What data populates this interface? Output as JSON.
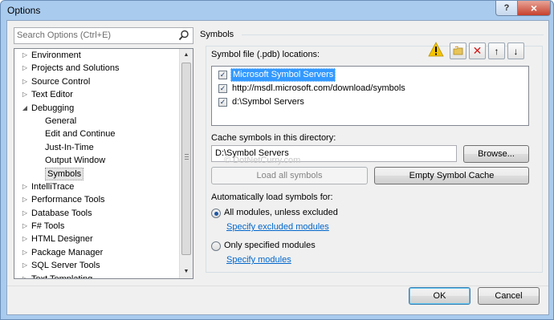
{
  "window": {
    "title": "Options",
    "help_glyph": "?",
    "close_glyph": "×"
  },
  "search": {
    "placeholder": "Search Options (Ctrl+E)"
  },
  "tree": [
    {
      "label": "Environment",
      "arrow": "▷",
      "level": 0
    },
    {
      "label": "Projects and Solutions",
      "arrow": "▷",
      "level": 0
    },
    {
      "label": "Source Control",
      "arrow": "▷",
      "level": 0
    },
    {
      "label": "Text Editor",
      "arrow": "▷",
      "level": 0
    },
    {
      "label": "Debugging",
      "arrow": "◢",
      "level": 0
    },
    {
      "label": "General",
      "arrow": "",
      "level": 1
    },
    {
      "label": "Edit and Continue",
      "arrow": "",
      "level": 1
    },
    {
      "label": "Just-In-Time",
      "arrow": "",
      "level": 1
    },
    {
      "label": "Output Window",
      "arrow": "",
      "level": 1
    },
    {
      "label": "Symbols",
      "arrow": "",
      "level": 1,
      "selected": true
    },
    {
      "label": "IntelliTrace",
      "arrow": "▷",
      "level": 0
    },
    {
      "label": "Performance Tools",
      "arrow": "▷",
      "level": 0
    },
    {
      "label": "Database Tools",
      "arrow": "▷",
      "level": 0
    },
    {
      "label": "F# Tools",
      "arrow": "▷",
      "level": 0
    },
    {
      "label": "HTML Designer",
      "arrow": "▷",
      "level": 0
    },
    {
      "label": "Package Manager",
      "arrow": "▷",
      "level": 0
    },
    {
      "label": "SQL Server Tools",
      "arrow": "▷",
      "level": 0
    },
    {
      "label": "Text Templating",
      "arrow": "▷",
      "level": 0
    }
  ],
  "symbols": {
    "section_title": "Symbols",
    "locations_label": "Symbol file (.pdb) locations:",
    "locations": [
      {
        "text": "Microsoft Symbol Servers",
        "checked": true,
        "selected": true
      },
      {
        "text": "http://msdl.microsoft.com/download/symbols",
        "checked": true,
        "selected": false
      },
      {
        "text": "d:\\Symbol Servers",
        "checked": true,
        "selected": false
      }
    ],
    "cache_label": "Cache symbols in this directory:",
    "cache_value": "D:\\Symbol Servers",
    "browse_label": "Browse...",
    "load_all_label": "Load all symbols",
    "empty_cache_label": "Empty Symbol Cache",
    "auto_load_label": "Automatically load symbols for:",
    "option_all": "All modules, unless excluded",
    "link_excluded": "Specify excluded modules",
    "option_specified": "Only specified modules",
    "link_modules": "Specify modules",
    "selected_option": "all"
  },
  "watermark": "© DotNetCurry.com",
  "footer": {
    "ok_label": "OK",
    "cancel_label": "Cancel"
  },
  "colors": {
    "title_bar": "#a9cbee",
    "close_button": "#c7412d",
    "selection": "#3399ff",
    "link": "#0066cc",
    "warning": "#f5c400",
    "delete": "#d11a1a"
  }
}
